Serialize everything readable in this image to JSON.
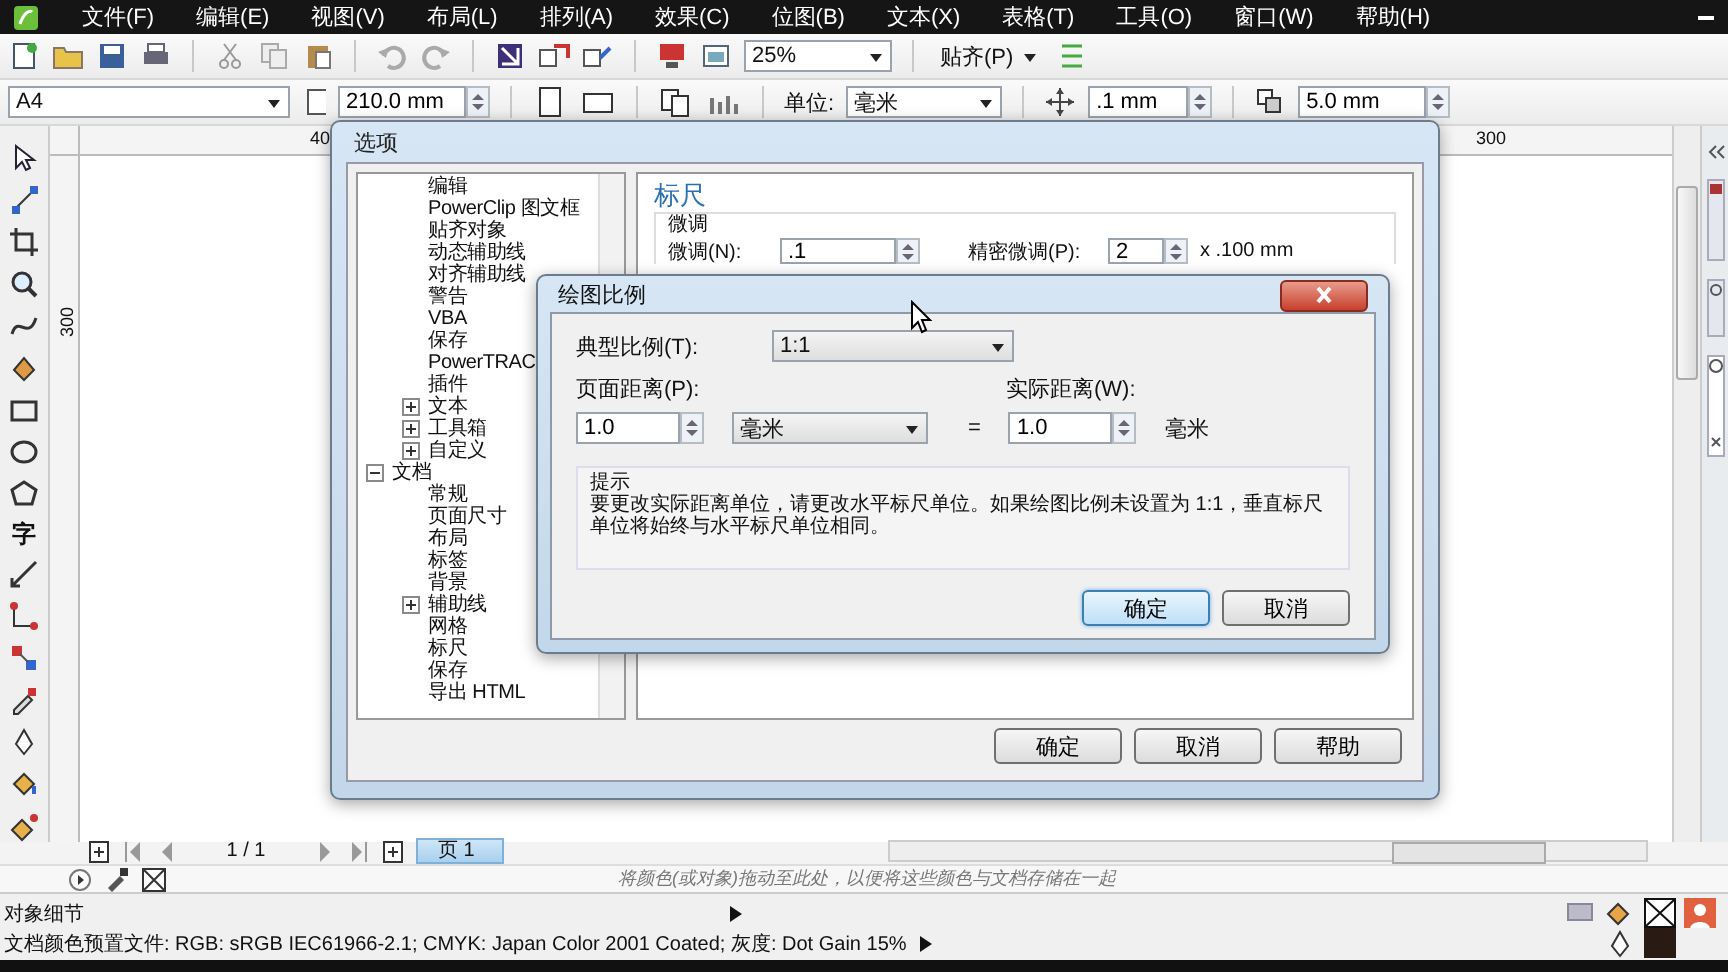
{
  "menu": [
    "文件(F)",
    "编辑(E)",
    "视图(V)",
    "布局(L)",
    "排列(A)",
    "效果(C)",
    "位图(B)",
    "文本(X)",
    "表格(T)",
    "工具(O)",
    "窗口(W)",
    "帮助(H)"
  ],
  "toolbar": {
    "zoom": "25%",
    "snap": "贴齐(P)"
  },
  "property_bar": {
    "page_size": "A4",
    "width": "210.0 mm",
    "unit_label": "单位:",
    "unit": "毫米",
    "nudge": ".1 mm",
    "duplicate_distance": "5.0 mm"
  },
  "toolbox": {
    "text_tool_glyph": "字"
  },
  "rulers": {
    "top_labels": [
      "40",
      "300"
    ],
    "left_label": "300"
  },
  "options_dialog": {
    "title": "选项",
    "tree_continued": [
      {
        "label": "编辑"
      },
      {
        "label": "PowerClip 图文框"
      },
      {
        "label": "贴齐对象"
      },
      {
        "label": "动态辅助线"
      },
      {
        "label": "对齐辅助线"
      },
      {
        "label": "警告"
      },
      {
        "label": "VBA"
      },
      {
        "label": "保存"
      },
      {
        "label": "PowerTRAC"
      },
      {
        "label": "插件"
      },
      {
        "label": "文本",
        "expanded": false
      },
      {
        "label": "工具箱",
        "expanded": false
      },
      {
        "label": "自定义",
        "expanded": false
      }
    ],
    "tree": [
      {
        "label": "文档",
        "expanded": true,
        "children": [
          {
            "label": "常规"
          },
          {
            "label": "页面尺寸"
          },
          {
            "label": "布局"
          },
          {
            "label": "标签"
          },
          {
            "label": "背景"
          },
          {
            "label": "辅助线",
            "expanded": false
          },
          {
            "label": "网格"
          },
          {
            "label": "标尺"
          },
          {
            "label": "保存"
          },
          {
            "label": "导出 HTML"
          }
        ]
      }
    ],
    "page_title": "标尺",
    "group": "微调",
    "fields": [
      {
        "label": "微调(N):",
        "value": ".1"
      },
      {
        "label": "精密微调(P):",
        "value": "2",
        "suffix": "x .100 mm"
      }
    ],
    "buttons": [
      "确定",
      "取消",
      "帮助"
    ]
  },
  "scale_dialog": {
    "title": "绘图比例",
    "typical_label": "典型比例(T):",
    "typical_value": "1:1",
    "page_label": "页面距离(P):",
    "page_value": "1.0",
    "page_unit": "毫米",
    "equals": "=",
    "world_label": "实际距离(W):",
    "world_value": "1.0",
    "world_unit": "毫米",
    "hint_title": "提示",
    "hint": "要更改实际距离单位，请更改水平标尺单位。如果绘图比例未设置为 1:1，垂直标尺单位将始终与水平标尺单位相同。",
    "buttons": [
      {
        "label": "确定",
        "default": true
      },
      {
        "label": "取消",
        "default": false
      }
    ]
  },
  "page_nav": {
    "counter": "1 / 1",
    "tab": "页 1"
  },
  "palette_hint": "将颜色(或对象)拖动至此处，以便将这些颜色与文档存储在一起",
  "status": {
    "object_details": "对象细节",
    "color_profile": "文档颜色预置文件: RGB: sRGB IEC61966-2.1; CMYK: Japan Color 2001 Coated; 灰度: Dot Gain 15%"
  }
}
